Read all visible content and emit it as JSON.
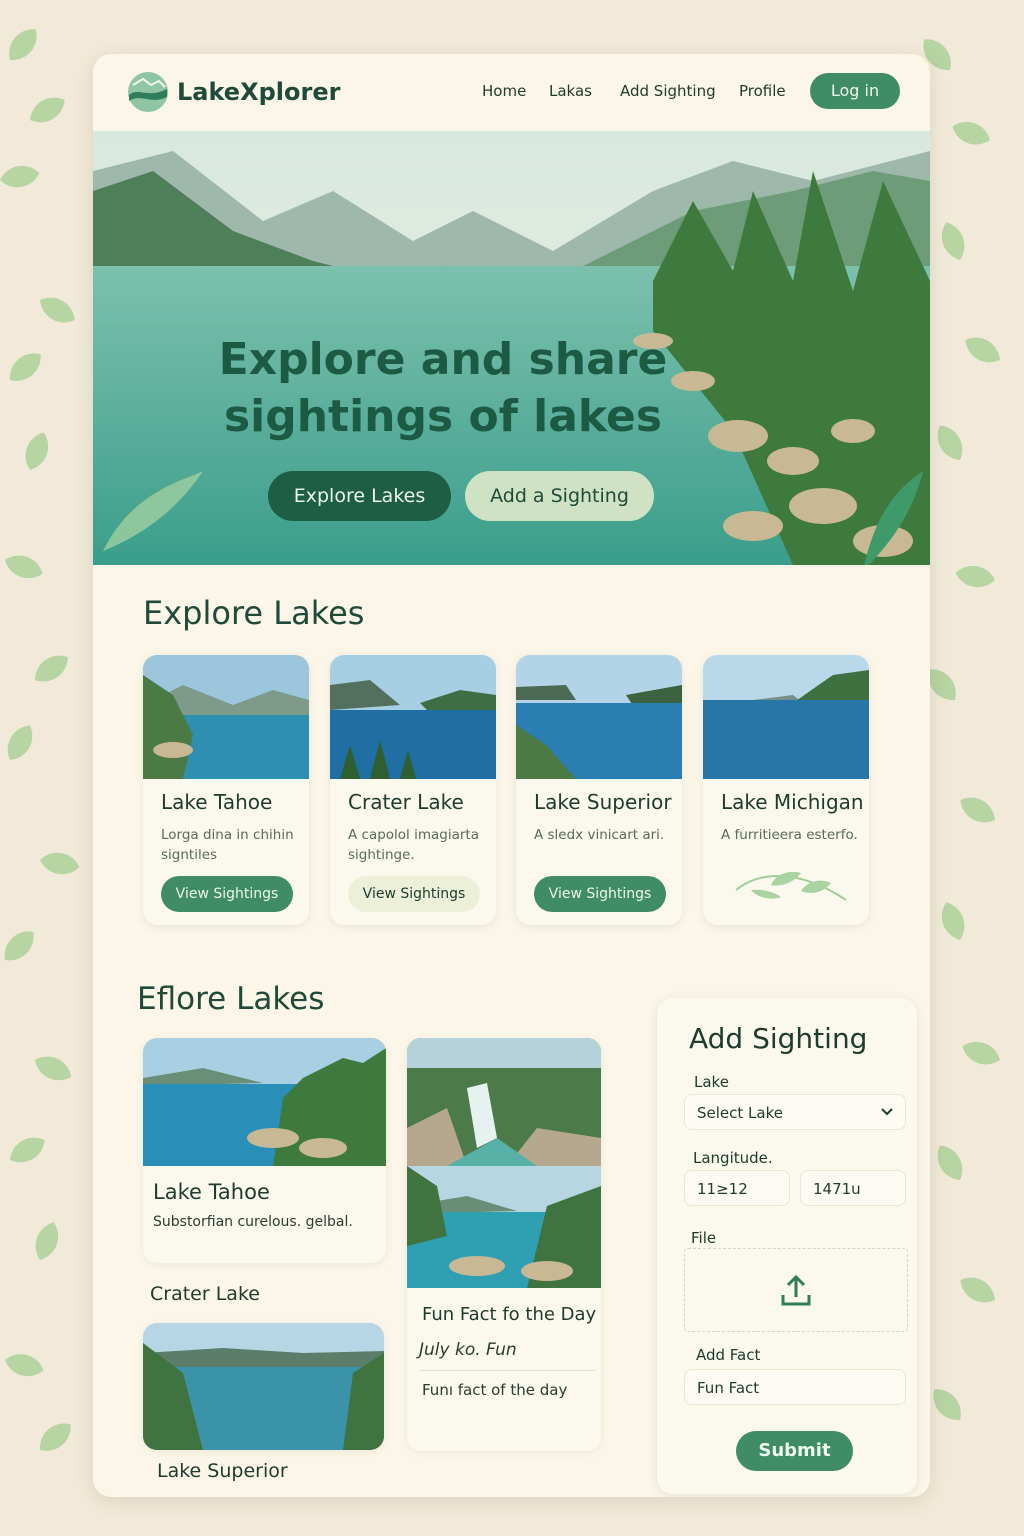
{
  "header": {
    "brand": "LakeXplorer",
    "nav": [
      "Home",
      "Lakas",
      "Add Sighting",
      "Profile"
    ],
    "login_label": "Log in"
  },
  "hero": {
    "title_line1": "Explore and share",
    "title_line2": "sightings of lakes",
    "primary_button": "Explore Lakes",
    "secondary_button": "Add a Sighting"
  },
  "explore": {
    "title": "Explore Lakes",
    "cards": [
      {
        "name": "Lake Tahoe",
        "description": "Lorga dina in chihin signtiles",
        "button": "View Sightings"
      },
      {
        "name": "Crater Lake",
        "description": "A capolol imagiarta sightinge.",
        "button": "View Sightings"
      },
      {
        "name": "Lake Superior",
        "description": "A sledx vinicart ari.",
        "button": "View Sightings"
      },
      {
        "name": "Lake Michigan",
        "description": "A furritieera esterfo.",
        "button": ""
      }
    ]
  },
  "gallery": {
    "title": "Eflore Lakes",
    "items": [
      {
        "name": "Lake Tahoe",
        "description": "Substorfian curelous. gelbal."
      },
      {
        "name": "Crater Lake"
      },
      {
        "name": "Lake Superior"
      }
    ],
    "fun_fact": {
      "title": "Fun Fact fo the Day",
      "italic": "July ko. Fun",
      "text": "Funı fact of the day"
    }
  },
  "form": {
    "title": "Add Sighting",
    "lake_label": "Lake",
    "lake_select": "Select Lake",
    "longitude_label": "Langitude.",
    "lat_value": "11≥12",
    "lon_value": "1471u",
    "file_label": "File",
    "fact_label": "Add Fact",
    "fact_value": "Fun Fact",
    "submit_label": "Submit"
  },
  "colors": {
    "accent": "#3f8c67",
    "accent_dark": "#1e5e45",
    "background": "#f1ead8",
    "card": "#fbf6e8"
  }
}
